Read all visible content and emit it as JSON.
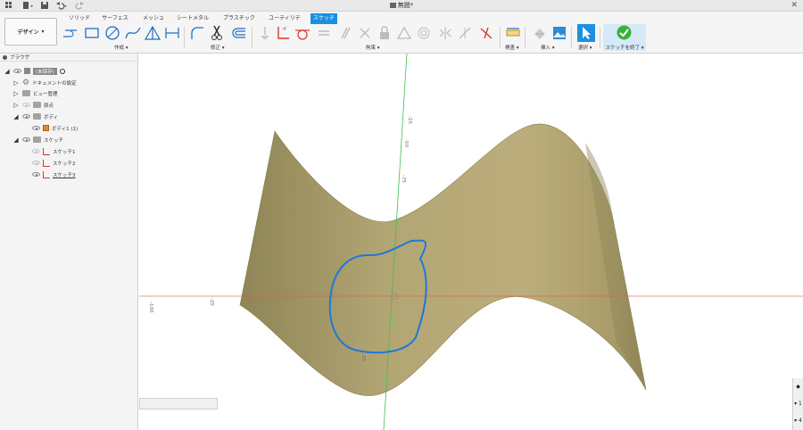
{
  "window": {
    "title": "無題*",
    "close_glyph": "✕"
  },
  "tabs": [
    {
      "label": "ソリッド"
    },
    {
      "label": "サーフェス"
    },
    {
      "label": "メッシュ"
    },
    {
      "label": "シートメタル"
    },
    {
      "label": "プラスチック"
    },
    {
      "label": "ユーティリティ"
    },
    {
      "label": "スケッチ"
    }
  ],
  "active_tab": "スケッチ",
  "workspace": {
    "label": "デザイン",
    "caret": "▾"
  },
  "groups": {
    "create": "作成 ▾",
    "modify": "修正 ▾",
    "constraints": "拘束 ▾",
    "inspect": "検査 ▾",
    "insert": "挿入 ▾",
    "select": "選択 ▾",
    "finish": "スケッチを終了 ▾"
  },
  "browser": {
    "header": "ブラウザ",
    "nodes": [
      {
        "label": "(未保存)",
        "icon": "component-icon"
      },
      {
        "label": "ドキュメントの設定",
        "icon": "gear-icon"
      },
      {
        "label": "ビュー管理",
        "icon": "folder-icon"
      },
      {
        "label": "原点",
        "icon": "folder-icon"
      },
      {
        "label": "ボディ",
        "icon": "folder-icon"
      },
      {
        "label": "ボディ1 (1)",
        "icon": "body-icon"
      },
      {
        "label": "スケッチ",
        "icon": "folder-icon"
      },
      {
        "label": "スケッチ1",
        "icon": "sketch-icon"
      },
      {
        "label": "スケッチ2",
        "icon": "sketch-icon"
      },
      {
        "label": "スケッチ3",
        "icon": "sketch-icon"
      }
    ]
  },
  "viewport": {
    "axis_labels": [
      "-25",
      "-50",
      "-75",
      "-100",
      "-25",
      "-100",
      "-75",
      "-25"
    ],
    "colors": {
      "surface": "#b5a877",
      "surface_dark": "#8c8256",
      "sketch": "#1f78d6",
      "x_axis": "#e05a4a",
      "y_axis": "#3fbf55"
    }
  },
  "nav_widget": [
    "◆",
    "▾ 1",
    "▾ 4"
  ]
}
